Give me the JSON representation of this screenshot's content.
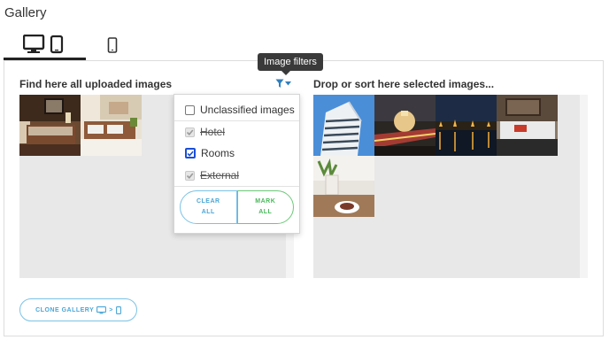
{
  "page": {
    "title": "Gallery"
  },
  "device_tabs": [
    {
      "icon": "desktop-tablet-icon",
      "active": true
    },
    {
      "icon": "mobile-icon",
      "active": false
    }
  ],
  "left_column": {
    "title": "Find here all uploaded images",
    "images": [
      {
        "name": "hotel-room-image-1"
      },
      {
        "name": "hotel-room-image-2"
      }
    ]
  },
  "right_column": {
    "title": "Drop or sort here selected images...",
    "images": [
      {
        "name": "modern-building-image"
      },
      {
        "name": "city-night-image"
      },
      {
        "name": "river-night-image"
      },
      {
        "name": "hotel-room-image-3"
      },
      {
        "name": "food-table-image"
      }
    ]
  },
  "filter": {
    "icon": "filter-icon",
    "tooltip": "Image filters",
    "options": [
      {
        "label": "Unclassified images",
        "checked": false,
        "disabled": false,
        "struck": false
      },
      {
        "label": "Hotel",
        "checked": true,
        "disabled": true,
        "struck": true
      },
      {
        "label": "Rooms",
        "checked": true,
        "disabled": false,
        "struck": false
      },
      {
        "label": "External",
        "checked": true,
        "disabled": true,
        "struck": true
      }
    ],
    "clear_all_label": "CLEAR\nALL",
    "mark_all_label": "MARK\nALL"
  },
  "clone_button": {
    "label": "CLONE GALLERY",
    "suffix": ">"
  },
  "colors": {
    "accent_blue": "#4aa6d6",
    "accent_green": "#49b85a",
    "checkbox_blue": "#1a4fd6",
    "dropzone_bg": "#e8e8e8"
  }
}
